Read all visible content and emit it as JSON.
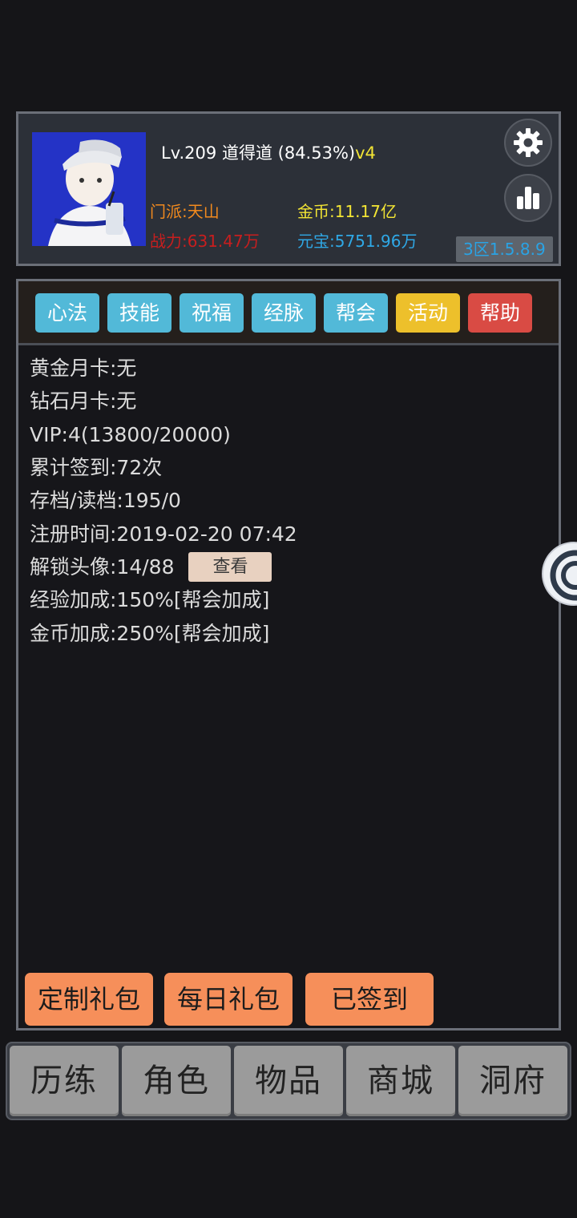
{
  "profile": {
    "level": "Lv.209",
    "name": "道得道",
    "progress": "(84.53%)",
    "vip_tag": "v4",
    "sect": "门派:天山",
    "power": "战力:631.47万",
    "gold": "金币:11.17亿",
    "ingot": "元宝:5751.96万",
    "server": "3区1.5.8.9"
  },
  "icons": {
    "settings": "gear-icon",
    "ranking": "bar-chart-icon",
    "floating": "concentric-circle-icon"
  },
  "tabs": [
    {
      "label": "心法",
      "color": "#52b9d8"
    },
    {
      "label": "技能",
      "color": "#52b9d8"
    },
    {
      "label": "祝福",
      "color": "#52b9d8"
    },
    {
      "label": "经脉",
      "color": "#52b9d8"
    },
    {
      "label": "帮会",
      "color": "#52b9d8"
    },
    {
      "label": "活动",
      "color": "#edc02b"
    },
    {
      "label": "帮助",
      "color": "#d94b44"
    }
  ],
  "info": {
    "gold_card": "黄金月卡:无",
    "diamond_card": "钻石月卡:无",
    "vip": "VIP:4(13800/20000)",
    "signin_total": "累计签到:72次",
    "saves": "存档/读档:195/0",
    "register_time": "注册时间:2019-02-20 07:42",
    "avatars": "解锁头像:14/88",
    "view_button": "查看",
    "exp_bonus": "经验加成:150%[帮会加成]",
    "gold_bonus": "金币加成:250%[帮会加成]"
  },
  "actions": {
    "custom_pack": "定制礼包",
    "daily_pack": "每日礼包",
    "signed_in": "已签到"
  },
  "nav": [
    "历练",
    "角色",
    "物品",
    "商城",
    "洞府"
  ]
}
